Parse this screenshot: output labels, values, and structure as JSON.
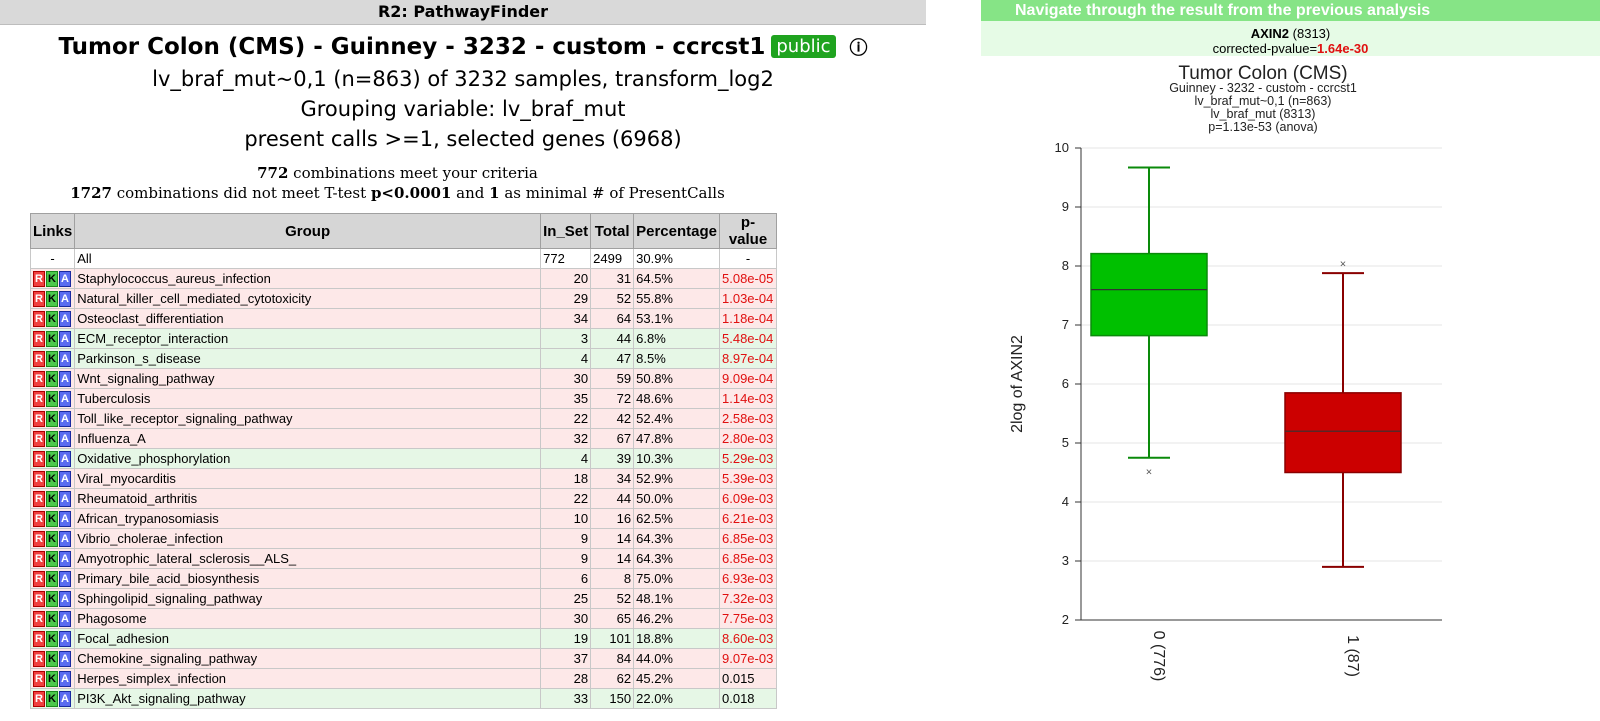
{
  "left": {
    "app_title": "R2: PathwayFinder",
    "dataset_title": "Tumor Colon (CMS) - Guinney - 3232 - custom - ccrcst1",
    "badge": "public",
    "info_icon": "info-icon",
    "line1": "lv_braf_mut~0,1 (n=863) of 3232 samples, transform_log2",
    "line2": "Grouping variable: lv_braf_mut",
    "line3": "present calls >=1, selected genes (6968)",
    "crit1_num": "772",
    "crit1_text": " combinations meet your criteria",
    "crit2_num": "1727",
    "crit2_a": " combinations did not meet T-test ",
    "crit2_p": "p<0.0001",
    "crit2_b": " and ",
    "crit2_one": "1",
    "crit2_c": " as minimal # of PresentCalls",
    "table": {
      "headers": [
        "Links",
        "Group",
        "In_Set",
        "Total",
        "Percentage",
        "p-value"
      ],
      "link_labels": [
        "R",
        "K",
        "A"
      ],
      "all_row": {
        "links": "-",
        "group": "All",
        "in_set": "772",
        "total": "2499",
        "pct": "30.9%",
        "pval": "-"
      },
      "rows": [
        {
          "group": "Staphylococcus_aureus_infection",
          "in_set": "20",
          "total": "31",
          "pct": "64.5%",
          "pval": "5.08e-05",
          "dir": "up",
          "red": true
        },
        {
          "group": "Natural_killer_cell_mediated_cytotoxicity",
          "in_set": "29",
          "total": "52",
          "pct": "55.8%",
          "pval": "1.03e-04",
          "dir": "up",
          "red": true
        },
        {
          "group": "Osteoclast_differentiation",
          "in_set": "34",
          "total": "64",
          "pct": "53.1%",
          "pval": "1.18e-04",
          "dir": "up",
          "red": true
        },
        {
          "group": "ECM_receptor_interaction",
          "in_set": "3",
          "total": "44",
          "pct": "6.8%",
          "pval": "5.48e-04",
          "dir": "dn",
          "red": true
        },
        {
          "group": "Parkinson_s_disease",
          "in_set": "4",
          "total": "47",
          "pct": "8.5%",
          "pval": "8.97e-04",
          "dir": "dn",
          "red": true
        },
        {
          "group": "Wnt_signaling_pathway",
          "in_set": "30",
          "total": "59",
          "pct": "50.8%",
          "pval": "9.09e-04",
          "dir": "up",
          "red": true
        },
        {
          "group": "Tuberculosis",
          "in_set": "35",
          "total": "72",
          "pct": "48.6%",
          "pval": "1.14e-03",
          "dir": "up",
          "red": true
        },
        {
          "group": "Toll_like_receptor_signaling_pathway",
          "in_set": "22",
          "total": "42",
          "pct": "52.4%",
          "pval": "2.58e-03",
          "dir": "up",
          "red": true
        },
        {
          "group": "Influenza_A",
          "in_set": "32",
          "total": "67",
          "pct": "47.8%",
          "pval": "2.80e-03",
          "dir": "up",
          "red": true
        },
        {
          "group": "Oxidative_phosphorylation",
          "in_set": "4",
          "total": "39",
          "pct": "10.3%",
          "pval": "5.29e-03",
          "dir": "dn",
          "red": true
        },
        {
          "group": "Viral_myocarditis",
          "in_set": "18",
          "total": "34",
          "pct": "52.9%",
          "pval": "5.39e-03",
          "dir": "up",
          "red": true
        },
        {
          "group": "Rheumatoid_arthritis",
          "in_set": "22",
          "total": "44",
          "pct": "50.0%",
          "pval": "6.09e-03",
          "dir": "up",
          "red": true
        },
        {
          "group": "African_trypanosomiasis",
          "in_set": "10",
          "total": "16",
          "pct": "62.5%",
          "pval": "6.21e-03",
          "dir": "up",
          "red": true
        },
        {
          "group": "Vibrio_cholerae_infection",
          "in_set": "9",
          "total": "14",
          "pct": "64.3%",
          "pval": "6.85e-03",
          "dir": "up",
          "red": true
        },
        {
          "group": "Amyotrophic_lateral_sclerosis__ALS_",
          "in_set": "9",
          "total": "14",
          "pct": "64.3%",
          "pval": "6.85e-03",
          "dir": "up",
          "red": true
        },
        {
          "group": "Primary_bile_acid_biosynthesis",
          "in_set": "6",
          "total": "8",
          "pct": "75.0%",
          "pval": "6.93e-03",
          "dir": "up",
          "red": true
        },
        {
          "group": "Sphingolipid_signaling_pathway",
          "in_set": "25",
          "total": "52",
          "pct": "48.1%",
          "pval": "7.32e-03",
          "dir": "up",
          "red": true
        },
        {
          "group": "Phagosome",
          "in_set": "30",
          "total": "65",
          "pct": "46.2%",
          "pval": "7.75e-03",
          "dir": "up",
          "red": true
        },
        {
          "group": "Focal_adhesion",
          "in_set": "19",
          "total": "101",
          "pct": "18.8%",
          "pval": "8.60e-03",
          "dir": "dn",
          "red": true
        },
        {
          "group": "Chemokine_signaling_pathway",
          "in_set": "37",
          "total": "84",
          "pct": "44.0%",
          "pval": "9.07e-03",
          "dir": "up",
          "red": true
        },
        {
          "group": "Herpes_simplex_infection",
          "in_set": "28",
          "total": "62",
          "pct": "45.2%",
          "pval": "0.015",
          "dir": "up",
          "red": false
        },
        {
          "group": "PI3K_Akt_signaling_pathway",
          "in_set": "33",
          "total": "150",
          "pct": "22.0%",
          "pval": "0.018",
          "dir": "dn",
          "red": false
        }
      ]
    }
  },
  "right": {
    "nav_title": "Navigate through the result from the previous analysis",
    "gene": "AXIN2",
    "gene_id": " (8313)",
    "pvalue_label": "corrected-pvalue=",
    "pvalue": "1.64e-30",
    "colors": {
      "group0": "#00c000",
      "group0_stroke": "#0a8a0a",
      "group1": "#cc0000",
      "group1_stroke": "#8a0000"
    }
  },
  "chart_data": {
    "type": "box",
    "title": "Tumor Colon (CMS)",
    "subtitles": [
      "Guinney - 3232 - custom - ccrcst1",
      "lv_braf_mut~0,1 (n=863)",
      "lv_braf_mut (8313)",
      "p=1.13e-53 (anova)"
    ],
    "ylabel": "2log of AXIN2",
    "xlabel": "",
    "ylim": [
      2,
      10
    ],
    "yticks": [
      2,
      3,
      4,
      5,
      6,
      7,
      8,
      9,
      10
    ],
    "grid": true,
    "categories": [
      "0 (776)",
      "1 (87)"
    ],
    "boxes": [
      {
        "name": "0 (776)",
        "min": 4.75,
        "q1": 6.82,
        "median": 7.6,
        "q3": 8.21,
        "max": 9.67,
        "outliers": [
          4.52
        ]
      },
      {
        "name": "1 (87)",
        "min": 2.9,
        "q1": 4.5,
        "median": 5.2,
        "q3": 5.85,
        "max": 7.88,
        "outliers": [
          8.04
        ]
      }
    ]
  }
}
